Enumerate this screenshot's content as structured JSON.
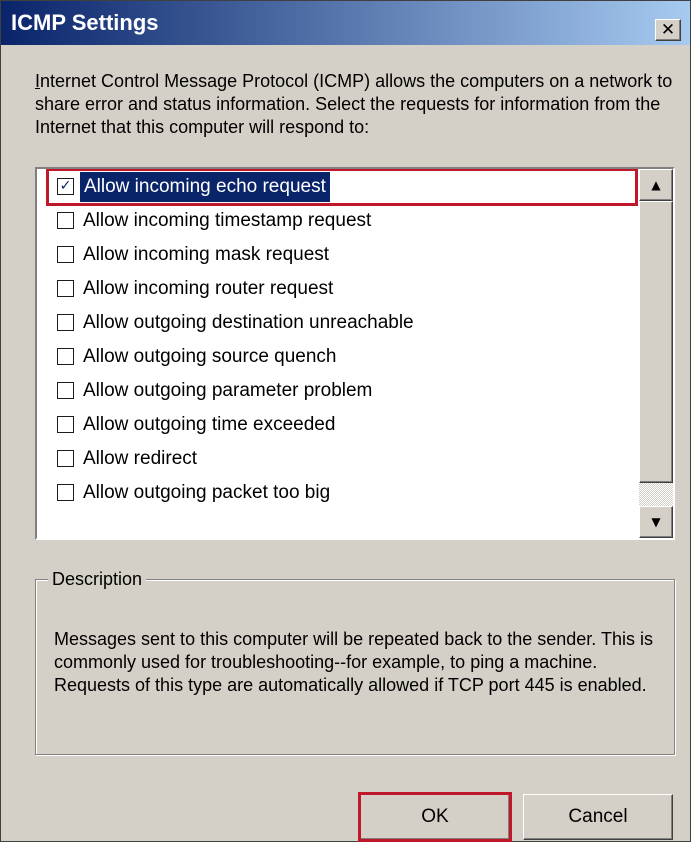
{
  "window": {
    "title": "ICMP Settings",
    "close_glyph": "✕"
  },
  "intro": {
    "access_key": "I",
    "text_rest": "nternet Control Message Protocol (ICMP) allows the computers on a network to share error and status information. Select the requests for information from the Internet that this computer will respond to:"
  },
  "list": {
    "items": [
      {
        "label": "Allow incoming echo request",
        "checked": true,
        "selected": true
      },
      {
        "label": "Allow incoming timestamp request",
        "checked": false
      },
      {
        "label": "Allow incoming mask request",
        "checked": false
      },
      {
        "label": "Allow incoming router request",
        "checked": false
      },
      {
        "label": "Allow outgoing destination unreachable",
        "checked": false
      },
      {
        "label": "Allow outgoing source quench",
        "checked": false
      },
      {
        "label": "Allow outgoing parameter problem",
        "checked": false
      },
      {
        "label": "Allow outgoing time exceeded",
        "checked": false
      },
      {
        "label": "Allow redirect",
        "checked": false
      },
      {
        "label": "Allow outgoing packet too big",
        "checked": false
      }
    ],
    "scroll_up_glyph": "▲",
    "scroll_down_glyph": "▼"
  },
  "description": {
    "legend": "Description",
    "text": "Messages sent to this computer will be repeated back to the sender. This is commonly used for troubleshooting--for example, to ping a machine. Requests of this type are automatically allowed if TCP port 445 is enabled."
  },
  "buttons": {
    "ok": "OK",
    "cancel": "Cancel"
  },
  "colors": {
    "dialog_bg": "#d4d0c8",
    "titlebar_start": "#0a246a",
    "titlebar_end": "#a6caf0",
    "highlight_outline": "#c0182a"
  }
}
